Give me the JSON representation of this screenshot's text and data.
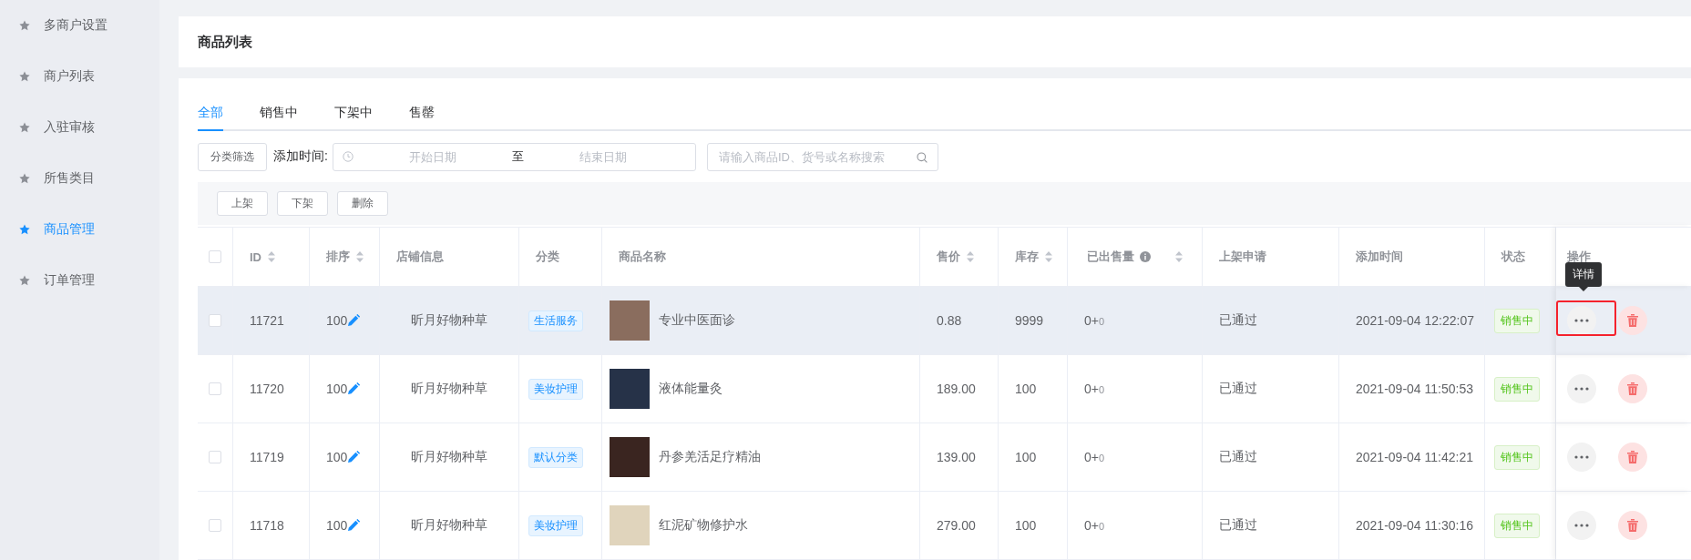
{
  "sidebar": {
    "items": [
      {
        "label": "多商户设置",
        "selected": false
      },
      {
        "label": "商户列表",
        "selected": false
      },
      {
        "label": "入驻审核",
        "selected": false
      },
      {
        "label": "所售类目",
        "selected": false
      },
      {
        "label": "商品管理",
        "selected": true
      },
      {
        "label": "订单管理",
        "selected": false
      }
    ]
  },
  "page_title": "商品列表",
  "tabs": [
    {
      "label": "全部",
      "selected": true
    },
    {
      "label": "销售中",
      "selected": false
    },
    {
      "label": "下架中",
      "selected": false
    },
    {
      "label": "售罄",
      "selected": false
    }
  ],
  "filters": {
    "category_button": "分类筛选",
    "date_label": "添加时间:",
    "date_range": {
      "start_placeholder": "开始日期",
      "separator": "至",
      "end_placeholder": "结束日期"
    },
    "search": {
      "placeholder": "请输入商品ID、货号或名称搜索"
    }
  },
  "bulk_actions": [
    "上架",
    "下架",
    "删除"
  ],
  "table": {
    "select_all_checked": false,
    "columns": [
      {
        "label": "ID",
        "sortable": true
      },
      {
        "label": "排序",
        "sortable": true
      },
      {
        "label": "店铺信息",
        "sortable": false
      },
      {
        "label": "分类",
        "sortable": false
      },
      {
        "label": "商品名称",
        "sortable": false
      },
      {
        "label": "售价",
        "sortable": true
      },
      {
        "label": "库存",
        "sortable": true
      },
      {
        "label": "已出售量",
        "sortable": true,
        "info": true
      },
      {
        "label": "上架申请",
        "sortable": false
      },
      {
        "label": "添加时间",
        "sortable": false
      },
      {
        "label": "状态",
        "sortable": false
      },
      {
        "label": "操作",
        "sortable": false
      }
    ],
    "rows": [
      {
        "checked": false,
        "hovered": true,
        "id": "11721",
        "sort": "100",
        "shop": "昕月好物种草",
        "category": "生活服务",
        "name": "专业中医面诊",
        "price": "0.88",
        "stock": "9999",
        "sold": "0+",
        "sold_pending": "0",
        "listing_request": "已通过",
        "added": "2021-09-04 12:22:07",
        "status": "销售中",
        "tooltip": "详情",
        "highlighted": true
      },
      {
        "checked": false,
        "hovered": false,
        "id": "11720",
        "sort": "100",
        "shop": "昕月好物种草",
        "category": "美妆护理",
        "name": "液体能量灸",
        "price": "189.00",
        "stock": "100",
        "sold": "0+",
        "sold_pending": "0",
        "listing_request": "已通过",
        "added": "2021-09-04 11:50:53",
        "status": "销售中",
        "highlighted": false
      },
      {
        "checked": false,
        "hovered": false,
        "id": "11719",
        "sort": "100",
        "shop": "昕月好物种草",
        "category": "默认分类",
        "name": "丹参羌活足疗精油",
        "price": "139.00",
        "stock": "100",
        "sold": "0+",
        "sold_pending": "0",
        "listing_request": "已通过",
        "added": "2021-09-04 11:42:21",
        "status": "销售中",
        "highlighted": false
      },
      {
        "checked": false,
        "hovered": false,
        "id": "11718",
        "sort": "100",
        "shop": "昕月好物种草",
        "category": "美妆护理",
        "name": "红泥矿物修护水",
        "price": "279.00",
        "stock": "100",
        "sold": "0+",
        "sold_pending": "0",
        "listing_request": "已通过",
        "added": "2021-09-04 11:30:16",
        "status": "销售中",
        "highlighted": false
      }
    ]
  }
}
